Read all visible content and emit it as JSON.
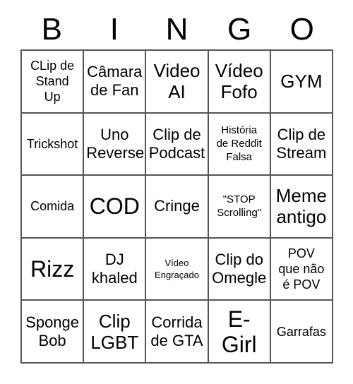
{
  "card": {
    "title": "BINGO",
    "header_letters": [
      "B",
      "I",
      "N",
      "G",
      "O"
    ],
    "border_color": "#555555",
    "text_color": "#000000",
    "background_color": "#ffffff",
    "columns": 5,
    "rows": 5,
    "cells": [
      {
        "text": "CLip de\nStand\nUp",
        "size": "fs-sm"
      },
      {
        "text": "Câmara\nde Fan",
        "size": "fs-md"
      },
      {
        "text": "Video\nAI",
        "size": "fs-lg"
      },
      {
        "text": "Vídeo\nFofo",
        "size": "fs-lg"
      },
      {
        "text": "GYM",
        "size": "fs-lg"
      },
      {
        "text": "Trickshot",
        "size": "fs-sm"
      },
      {
        "text": "Uno\nReverse",
        "size": "fs-md"
      },
      {
        "text": "Clip de\nPodcast",
        "size": "fs-md"
      },
      {
        "text": "História\nde Reddit\nFalsa",
        "size": "fs-xs"
      },
      {
        "text": "Clip de\nStream",
        "size": "fs-md"
      },
      {
        "text": "Comida",
        "size": "fs-sm"
      },
      {
        "text": "COD",
        "size": "fs-xl"
      },
      {
        "text": "Cringe",
        "size": "fs-md"
      },
      {
        "text": "\"STOP\nScrolling\"",
        "size": "fs-xs"
      },
      {
        "text": "Meme\nantigo",
        "size": "fs-lg"
      },
      {
        "text": "Rizz",
        "size": "fs-xl"
      },
      {
        "text": "DJ\nkhaled",
        "size": "fs-md"
      },
      {
        "text": "Vídeo\nEngraçado",
        "size": "fs-xxs"
      },
      {
        "text": "Clip do\nOmegle",
        "size": "fs-md"
      },
      {
        "text": "POV\nque não\né POV",
        "size": "fs-sm"
      },
      {
        "text": "Sponge\nBob",
        "size": "fs-md"
      },
      {
        "text": "Clip\nLGBT",
        "size": "fs-lg"
      },
      {
        "text": "Corrida\nde GTA",
        "size": "fs-md"
      },
      {
        "text": "E-\nGirl",
        "size": "fs-xl"
      },
      {
        "text": "Garrafas",
        "size": "fs-sm"
      }
    ]
  }
}
